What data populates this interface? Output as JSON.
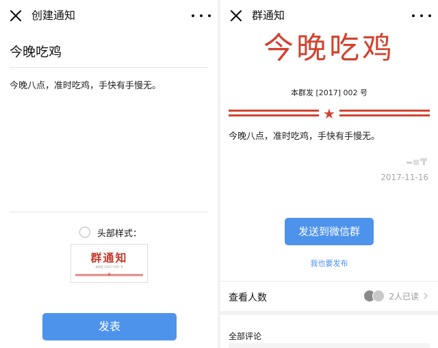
{
  "left_panel": {
    "nav": {
      "title": "创建通知"
    },
    "title_input_value": "今晚吃鸡",
    "body_text": "今晚八点，准时吃鸡，手快有手慢无。",
    "header_style_label": "头部样式：",
    "thumbnail": {
      "title": "群通知",
      "subtitle": "本群发 [2017] 002 号"
    },
    "publish_button": "发表"
  },
  "right_panel": {
    "nav": {
      "title": "群通知"
    },
    "big_title": "今晚吃鸡",
    "doc_number": "本群发 [2017] 002 号",
    "body_text": "今晚八点，准时吃鸡，手快有手慢无。",
    "date": "2017-11-16",
    "send_button": "发送到微信群",
    "publish_link": "我也要发布",
    "viewers": {
      "label": "查看人数",
      "read_count": "2人已读"
    },
    "comments_label": "全部评论"
  },
  "colors": {
    "accent_blue": "#4d93ec",
    "header_red": "#d2432f",
    "date_gray": "#a8a8a8"
  },
  "icons": [
    "close-icon",
    "more-dots-icon",
    "radio-circle-icon",
    "star-icon",
    "chevron-right-icon",
    "signature-icon"
  ]
}
